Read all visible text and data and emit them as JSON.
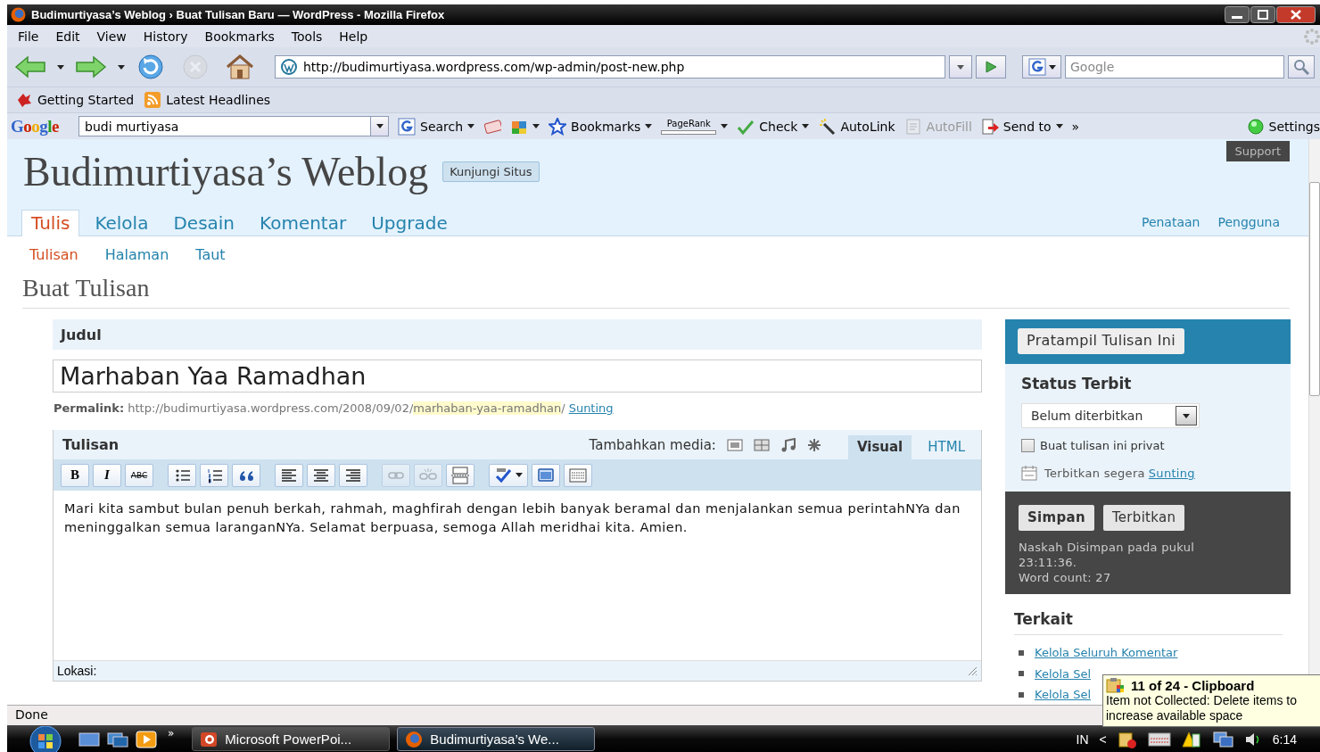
{
  "window": {
    "title": "Budimurtiyasa’s Weblog › Buat Tulisan Baru — WordPress - Mozilla Firefox"
  },
  "menu": [
    "File",
    "Edit",
    "View",
    "History",
    "Bookmarks",
    "Tools",
    "Help"
  ],
  "nav_buttons": [
    {
      "kind": "back",
      "disabled": false
    },
    {
      "kind": "forward",
      "disabled": false
    },
    {
      "kind": "reload",
      "disabled": false
    },
    {
      "kind": "stop",
      "disabled": true
    },
    {
      "kind": "home",
      "disabled": false
    }
  ],
  "address": {
    "url": "http://budimurtiyasa.wordpress.com/wp-admin/post-new.php",
    "search_placeholder": "Google"
  },
  "bookmarks": [
    {
      "kind": "getting-started",
      "label": "Getting Started"
    },
    {
      "kind": "feed",
      "label": "Latest Headlines"
    }
  ],
  "google_toolbar": {
    "logo": "Google",
    "query": "budi murtiyasa",
    "items": [
      {
        "kind": "search",
        "label": "Search",
        "menu": true,
        "disabled": false
      },
      {
        "kind": "news",
        "menu": false,
        "disabled": false
      },
      {
        "kind": "puzzle",
        "menu": true,
        "disabled": false
      },
      {
        "kind": "bookmarks",
        "label": "Bookmarks",
        "menu": true,
        "disabled": false
      },
      {
        "kind": "pagerank",
        "label": "PageRank",
        "menu": true,
        "disabled": false
      },
      {
        "kind": "check",
        "label": "Check",
        "menu": true,
        "disabled": false
      },
      {
        "kind": "autolink",
        "label": "AutoLink",
        "menu": false,
        "disabled": false
      },
      {
        "kind": "autofill",
        "label": "AutoFill",
        "menu": false,
        "disabled": true
      },
      {
        "kind": "sendto",
        "label": "Send to",
        "menu": true,
        "disabled": false
      },
      {
        "kind": "more",
        "label": "»",
        "menu": false,
        "disabled": false
      },
      {
        "kind": "settings",
        "label": "Settings",
        "menu": false,
        "disabled": false
      }
    ]
  },
  "blog": {
    "title": "Budimurtiyasa’s Weblog",
    "visit_button": "Kunjungi Situs",
    "support_button": "Support"
  },
  "tabs": [
    {
      "label": "Tulis",
      "selected": true
    },
    {
      "label": "Kelola",
      "selected": false
    },
    {
      "label": "Desain",
      "selected": false
    },
    {
      "label": "Komentar",
      "selected": false
    },
    {
      "label": "Upgrade",
      "selected": false
    }
  ],
  "tabs_right": [
    "Penataan",
    "Pengguna"
  ],
  "subtabs": [
    {
      "label": "Tulisan",
      "selected": true
    },
    {
      "label": "Halaman",
      "selected": false
    },
    {
      "label": "Taut",
      "selected": false
    }
  ],
  "heading": "Buat Tulisan",
  "title_box": {
    "label": "Judul",
    "value": "Marhaban Yaa Ramadhan"
  },
  "permalink": {
    "label": "Permalink:",
    "base": "http://budimurtiyasa.wordpress.com/2008/09/02/",
    "slug": "marhaban-yaa-ramadhan",
    "separator": "/",
    "edit_link": "Sunting"
  },
  "editor": {
    "label": "Tulisan",
    "media_label": "Tambahkan media:",
    "modes": [
      {
        "label": "Visual",
        "selected": true
      },
      {
        "label": "HTML",
        "selected": false
      }
    ],
    "toolbar": [
      {
        "kind": "bold",
        "label": "B",
        "disabled": false
      },
      {
        "kind": "italic",
        "label": "I",
        "disabled": false
      },
      {
        "kind": "strike",
        "label": "ABC",
        "disabled": false
      },
      {
        "kind": "bullets",
        "disabled": false
      },
      {
        "kind": "numbers",
        "disabled": false
      },
      {
        "kind": "quote",
        "disabled": false
      },
      {
        "kind": "align-left",
        "disabled": false
      },
      {
        "kind": "align-center",
        "disabled": false
      },
      {
        "kind": "align-right",
        "disabled": false
      },
      {
        "kind": "link",
        "disabled": true
      },
      {
        "kind": "unlink",
        "disabled": true
      },
      {
        "kind": "more",
        "disabled": false
      },
      {
        "kind": "spellcheck",
        "disabled": false
      },
      {
        "kind": "fullscreen",
        "disabled": false
      },
      {
        "kind": "kitchen-sink",
        "disabled": false
      }
    ],
    "content": "Mari kita sambut bulan penuh berkah, rahmah, maghfirah dengan lebih banyak beramal dan menjalankan semua perintahNYa dan meninggalkan semua laranganNYa. Selamat berpuasa, semoga Allah meridhai kita. Amien.",
    "location_label": "Lokasi:"
  },
  "sidebar": {
    "preview_button": "Pratampil Tulisan Ini",
    "status_heading": "Status Terbit",
    "status_value": "Belum diterbitkan",
    "private": {
      "label": "Buat tulisan ini privat",
      "checked": false
    },
    "schedule": {
      "text": "Terbitkan segera",
      "edit_link": "Sunting"
    },
    "buttons": [
      {
        "label": "Simpan",
        "primary": true
      },
      {
        "label": "Terbitkan",
        "primary": false
      }
    ],
    "saved_note": "Naskah Disimpan pada pukul 23:11:36.",
    "word_count": "Word count: 27",
    "related_heading": "Terkait",
    "related_links": [
      "Kelola Seluruh Komentar",
      "Kelola Sel",
      "Kelola Sel"
    ]
  },
  "status_bar": "Done",
  "taskbar": {
    "more": "»",
    "tasks": [
      {
        "label": "Microsoft PowerPoi...",
        "kind": "powerpoint",
        "selected": false
      },
      {
        "label": "Budimurtiyasa’s We...",
        "kind": "firefox",
        "selected": true
      }
    ],
    "language": "IN",
    "tray_toggle": "<",
    "clock": "6:14"
  },
  "notification": {
    "title": "11 of 24 - Clipboard",
    "message": "Item not Collected: Delete items to increase available space"
  }
}
